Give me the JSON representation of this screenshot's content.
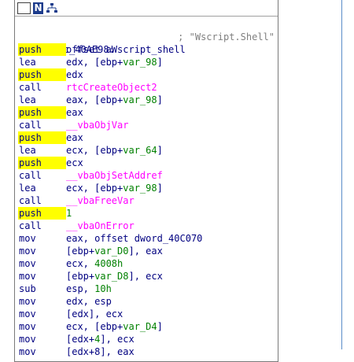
{
  "toolbar": {
    "icons": [
      "color-icon",
      "n-icon",
      "graph-icon"
    ],
    "n_label": "N"
  },
  "label_line": {
    "label": "loc_40AE98:",
    "comment": "; \"Wscript.Shell\""
  },
  "instructions": [
    {
      "mnemonic": "push",
      "highlight": true,
      "parts": [
        {
          "t": "offset aWscript_shell",
          "c": "ops"
        }
      ]
    },
    {
      "mnemonic": "lea",
      "highlight": false,
      "parts": [
        {
          "t": "edx, [ebp+",
          "c": "ops"
        },
        {
          "t": "var_98",
          "c": "var"
        },
        {
          "t": "]",
          "c": "ops"
        }
      ]
    },
    {
      "mnemonic": "push",
      "highlight": true,
      "parts": [
        {
          "t": "edx",
          "c": "ops"
        }
      ]
    },
    {
      "mnemonic": "call",
      "highlight": false,
      "parts": [
        {
          "t": "rtcCreateObject2",
          "c": "fn"
        }
      ]
    },
    {
      "mnemonic": "lea",
      "highlight": false,
      "parts": [
        {
          "t": "eax, [ebp+",
          "c": "ops"
        },
        {
          "t": "var_98",
          "c": "var"
        },
        {
          "t": "]",
          "c": "ops"
        }
      ]
    },
    {
      "mnemonic": "push",
      "highlight": true,
      "parts": [
        {
          "t": "eax",
          "c": "ops"
        }
      ]
    },
    {
      "mnemonic": "call",
      "highlight": false,
      "parts": [
        {
          "t": "__vbaObjVar",
          "c": "fn"
        }
      ]
    },
    {
      "mnemonic": "push",
      "highlight": true,
      "parts": [
        {
          "t": "eax",
          "c": "ops"
        }
      ]
    },
    {
      "mnemonic": "lea",
      "highlight": false,
      "parts": [
        {
          "t": "ecx, [ebp+",
          "c": "ops"
        },
        {
          "t": "var_64",
          "c": "var"
        },
        {
          "t": "]",
          "c": "ops"
        }
      ]
    },
    {
      "mnemonic": "push",
      "highlight": true,
      "parts": [
        {
          "t": "ecx",
          "c": "ops"
        }
      ]
    },
    {
      "mnemonic": "call",
      "highlight": false,
      "parts": [
        {
          "t": "__vbaObjSetAddref",
          "c": "fn"
        }
      ]
    },
    {
      "mnemonic": "lea",
      "highlight": false,
      "parts": [
        {
          "t": "ecx, [ebp+",
          "c": "ops"
        },
        {
          "t": "var_98",
          "c": "var"
        },
        {
          "t": "]",
          "c": "ops"
        }
      ]
    },
    {
      "mnemonic": "call",
      "highlight": false,
      "parts": [
        {
          "t": "__vbaFreeVar",
          "c": "fn"
        }
      ]
    },
    {
      "mnemonic": "push",
      "highlight": true,
      "parts": [
        {
          "t": "1",
          "c": "num"
        }
      ]
    },
    {
      "mnemonic": "call",
      "highlight": false,
      "parts": [
        {
          "t": "__vbaOnError",
          "c": "fn"
        }
      ]
    },
    {
      "mnemonic": "mov",
      "highlight": false,
      "parts": [
        {
          "t": "eax, offset dword_40C070",
          "c": "ops"
        }
      ]
    },
    {
      "mnemonic": "mov",
      "highlight": false,
      "parts": [
        {
          "t": "[ebp+",
          "c": "ops"
        },
        {
          "t": "var_D0",
          "c": "var"
        },
        {
          "t": "], eax",
          "c": "ops"
        }
      ]
    },
    {
      "mnemonic": "mov",
      "highlight": false,
      "parts": [
        {
          "t": "ecx, ",
          "c": "ops"
        },
        {
          "t": "4008h",
          "c": "num"
        }
      ]
    },
    {
      "mnemonic": "mov",
      "highlight": false,
      "parts": [
        {
          "t": "[ebp+",
          "c": "ops"
        },
        {
          "t": "var_D8",
          "c": "var"
        },
        {
          "t": "], ecx",
          "c": "ops"
        }
      ]
    },
    {
      "mnemonic": "sub",
      "highlight": false,
      "parts": [
        {
          "t": "esp, ",
          "c": "ops"
        },
        {
          "t": "10h",
          "c": "num"
        }
      ]
    },
    {
      "mnemonic": "mov",
      "highlight": false,
      "parts": [
        {
          "t": "edx, esp",
          "c": "ops"
        }
      ]
    },
    {
      "mnemonic": "mov",
      "highlight": false,
      "parts": [
        {
          "t": "[edx], ecx",
          "c": "ops"
        }
      ]
    },
    {
      "mnemonic": "mov",
      "highlight": false,
      "parts": [
        {
          "t": "ecx, [ebp+",
          "c": "ops"
        },
        {
          "t": "var_D4",
          "c": "var"
        },
        {
          "t": "]",
          "c": "ops"
        }
      ]
    },
    {
      "mnemonic": "mov",
      "highlight": false,
      "parts": [
        {
          "t": "[edx+",
          "c": "ops"
        },
        {
          "t": "4",
          "c": "num"
        },
        {
          "t": "], ecx",
          "c": "ops"
        }
      ]
    },
    {
      "mnemonic": "mov",
      "highlight": false,
      "parts": [
        {
          "t": "[edx+8], eax",
          "c": "ops"
        }
      ]
    }
  ],
  "colors": {
    "push_highlight": "#ffff00",
    "mnemonic": "#000080",
    "variable": "#008000",
    "function": "#ff00ff",
    "comment": "#808080"
  }
}
